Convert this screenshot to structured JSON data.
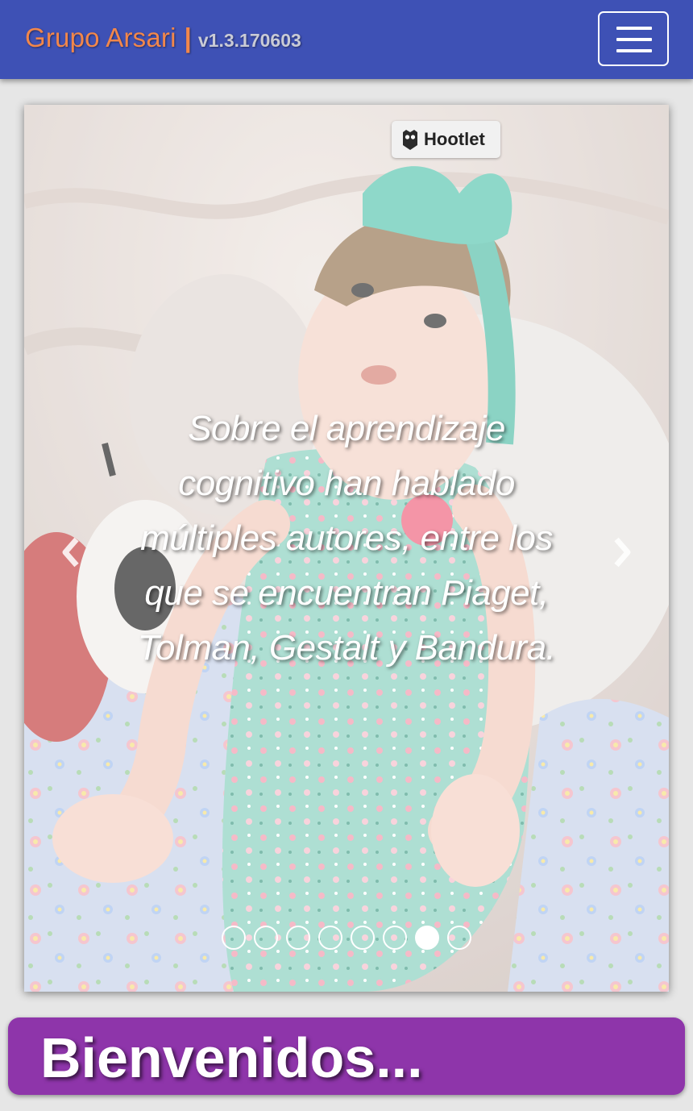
{
  "navbar": {
    "brand_name": "Grupo Arsari",
    "brand_separator": "|",
    "version": "v1.3.170603",
    "menu_icon": "hamburger-menu-icon",
    "colors": {
      "background": "#3e51b5",
      "brand": "#f2874b",
      "version": "#c9cbd6"
    }
  },
  "carousel": {
    "overlay_badge": "Hootlet",
    "caption": "Sobre el aprendizaje cognitivo han hablado múltiples autores, entre los que se encuentran Piaget, Tolman, Gestalt y Bandura.",
    "prev_icon": "chevron-left-icon",
    "next_icon": "chevron-right-icon",
    "slide_count": 8,
    "active_slide": 7
  },
  "welcome": {
    "title": "Bienvenidos...",
    "color": "#8e35aa"
  }
}
